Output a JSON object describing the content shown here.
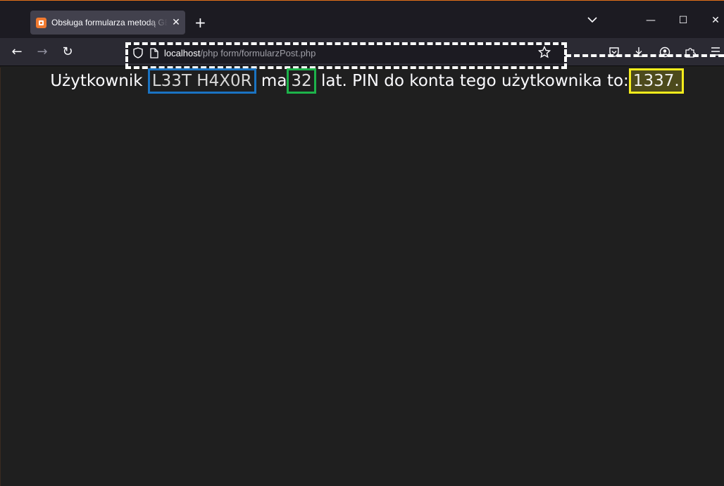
{
  "browser": {
    "tab": {
      "title": "Obsługa formularza metodą GET",
      "close_glyph": "✕",
      "favicon": "xampp-icon"
    },
    "new_tab_glyph": "+",
    "window_controls": {
      "list": "list-all-tabs-icon",
      "minimize": "—",
      "maximize": "☐",
      "close": "✕"
    },
    "nav": {
      "back": "←",
      "forward": "→",
      "reload": "↻"
    },
    "url": {
      "host": "localhost",
      "path": "/php form/formularzPost.php"
    },
    "toolbar_icons": [
      "pocket-icon",
      "download-icon",
      "account-icon",
      "extensions-icon",
      "menu-icon"
    ]
  },
  "page": {
    "prefix": "Użytkownik",
    "username": "L33T H4X0R",
    "middle": "ma",
    "age": "32",
    "suffix": "lat. PIN do konta tego użytkownika to:",
    "pin": "1337."
  },
  "colors": {
    "accent_orange": "#e2701a",
    "highlight_username": "#1a73c2",
    "highlight_age": "#1db34a",
    "highlight_pin": "#f4ec1c",
    "page_background": "#1f1f1f"
  }
}
